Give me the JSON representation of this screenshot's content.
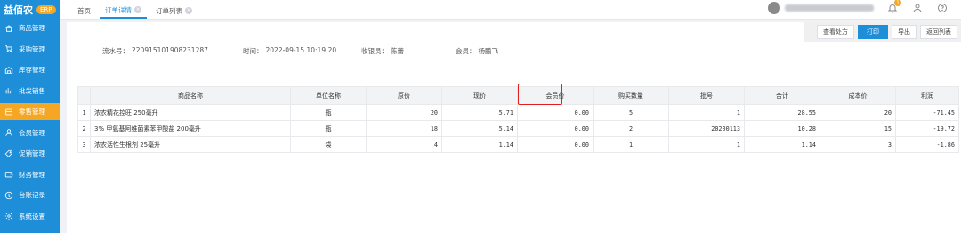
{
  "brand": {
    "name": "益佰农",
    "badge": "ERP"
  },
  "sidebar": {
    "items": [
      {
        "label": "商品管理",
        "icon": "bag-icon",
        "active": false
      },
      {
        "label": "采购管理",
        "icon": "cart-icon",
        "active": false
      },
      {
        "label": "库存管理",
        "icon": "warehouse-icon",
        "active": false
      },
      {
        "label": "批发销售",
        "icon": "bar-chart-icon",
        "active": false
      },
      {
        "label": "零售管理",
        "icon": "store-icon",
        "active": true
      },
      {
        "label": "会员管理",
        "icon": "user-icon",
        "active": false
      },
      {
        "label": "促销管理",
        "icon": "tag-icon",
        "active": false
      },
      {
        "label": "财务管理",
        "icon": "wallet-icon",
        "active": false
      },
      {
        "label": "台账记录",
        "icon": "clock-icon",
        "active": false
      },
      {
        "label": "系统设置",
        "icon": "gear-icon",
        "active": false
      }
    ]
  },
  "tabs": [
    {
      "label": "首页",
      "active": false,
      "closable": false
    },
    {
      "label": "订单详情",
      "active": true,
      "closable": true
    },
    {
      "label": "订单列表",
      "active": false,
      "closable": true
    }
  ],
  "header": {
    "notification_count": "1"
  },
  "actions": {
    "view_prescription": "查看处方",
    "print": "打印",
    "export": "导出",
    "back_to_list": "返回列表"
  },
  "order_info": {
    "serial_label": "流水号：",
    "serial_value": "220915101908231287",
    "time_label": "时间：",
    "time_value": "2022-09-15 10:19:20",
    "cashier_label": "收银员：",
    "cashier_value": "陈蕾",
    "member_label": "会员：",
    "member_value": "杨鹏飞"
  },
  "table": {
    "headers": [
      "",
      "商品名称",
      "单位名称",
      "原价",
      "现价",
      "会员价",
      "购买数量",
      "批号",
      "合计",
      "成本价",
      "利润"
    ],
    "rows": [
      [
        "1",
        "浓农精花控旺 250毫升",
        "瓶",
        "20",
        "5.71",
        "0.00",
        "5",
        "1",
        "28.55",
        "20",
        "-71.45"
      ],
      [
        "2",
        "3% 甲氨基阿维菌素苯甲酸盐 200毫升",
        "瓶",
        "18",
        "5.14",
        "0.00",
        "2",
        "20200113",
        "10.28",
        "15",
        "-19.72"
      ],
      [
        "3",
        "浓农活性生根剂 25毫升",
        "袋",
        "4",
        "1.14",
        "0.00",
        "1",
        "1",
        "1.14",
        "3",
        "-1.86"
      ]
    ]
  },
  "colors": {
    "sidebar": "#1f8ed8",
    "accent": "#f5a623",
    "primary": "#1f8ed8",
    "highlight": "#e02020"
  }
}
